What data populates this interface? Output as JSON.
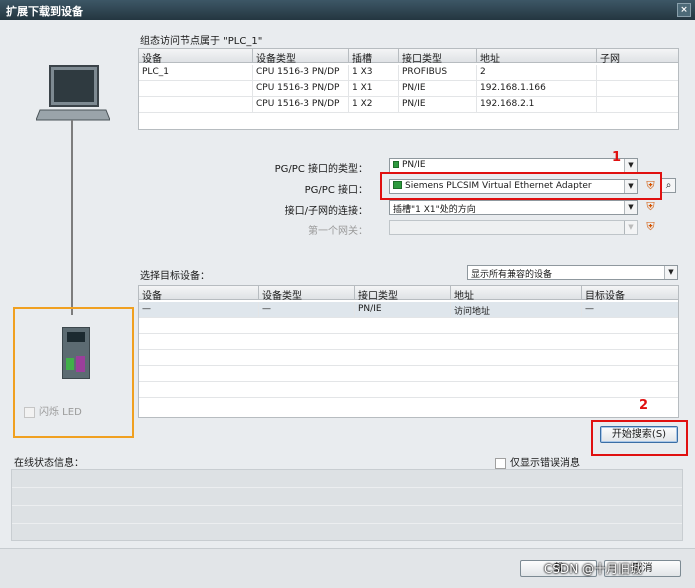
{
  "window": {
    "title": "扩展下载到设备",
    "close_glyph": "×"
  },
  "config_section": {
    "caption": "组态访问节点属于 \"PLC_1\"",
    "columns": [
      "设备",
      "设备类型",
      "插槽",
      "接口类型",
      "地址",
      "子网"
    ],
    "rows": [
      [
        "PLC_1",
        "CPU 1516-3 PN/DP",
        "1 X3",
        "PROFIBUS",
        "2",
        ""
      ],
      [
        "",
        "CPU 1516-3 PN/DP",
        "1 X1",
        "PN/IE",
        "192.168.1.166",
        ""
      ],
      [
        "",
        "CPU 1516-3 PN/DP",
        "1 X2",
        "PN/IE",
        "192.168.2.1",
        ""
      ]
    ]
  },
  "interface": {
    "pgpc_type_label": "PG/PC 接口的类型：",
    "pgpc_type_value": "PN/IE",
    "pgpc_interface_label": "PG/PC 接口：",
    "pgpc_interface_value": "Siemens PLCSIM Virtual Ethernet Adapter",
    "subnet_conn_label": "接口/子网的连接：",
    "subnet_conn_value": "插槽\"1 X1\"处的方向",
    "gateway_label": "第一个网关：",
    "gateway_value": ""
  },
  "target_section": {
    "caption": "选择目标设备：",
    "filter_value": "显示所有兼容的设备",
    "columns": [
      "设备",
      "设备类型",
      "接口类型",
      "地址",
      "目标设备"
    ],
    "rows": [
      [
        "—",
        "—",
        "PN/IE",
        "访问地址",
        "—"
      ]
    ]
  },
  "left_pane": {
    "flash_led_label": "闪烁 LED"
  },
  "actions": {
    "start_search_label": "开始搜索(S)"
  },
  "status": {
    "caption": "在线状态信息：",
    "errors_only_label": "仅显示错误消息"
  },
  "footer": {
    "cancel_label": "取消",
    "download_label": "载"
  },
  "annotations": {
    "marker_1": "1",
    "marker_2": "2"
  },
  "watermark": "CSDN @十月旧城",
  "colors": {
    "highlight_red": "#e01010",
    "target_orange": "#f0a020",
    "titlebar": "#2f4552"
  }
}
